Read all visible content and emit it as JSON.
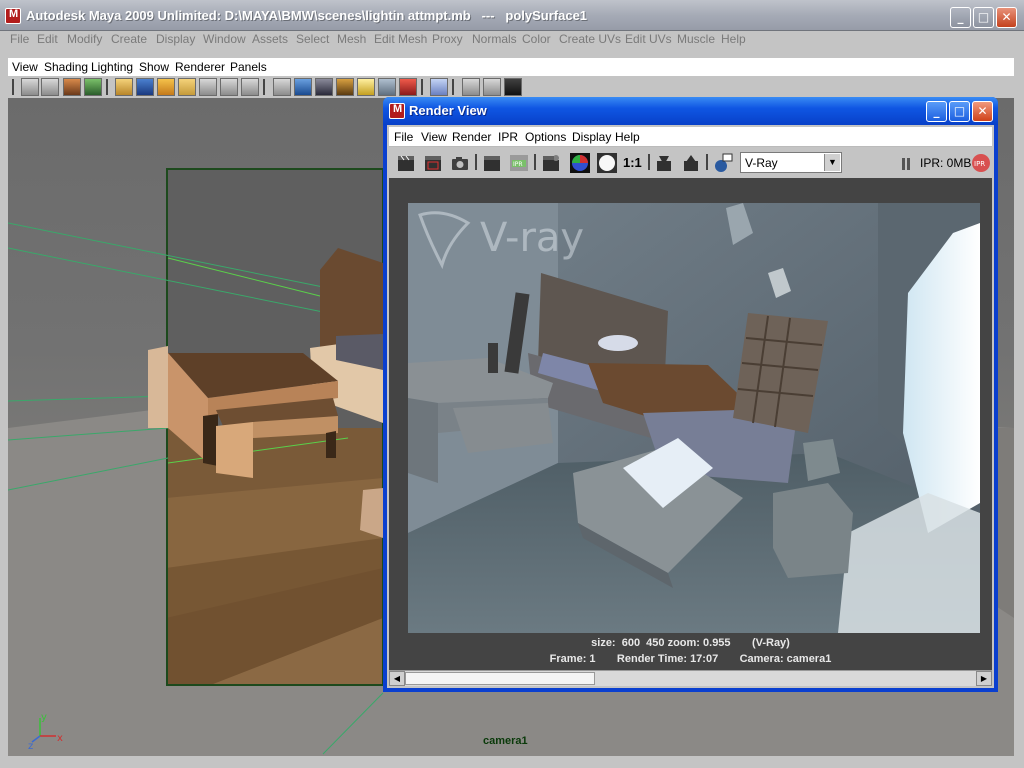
{
  "main_window": {
    "title": "Autodesk Maya 2009 Unlimited: D:\\MAYA\\BMW\\scenes\\lightin attmpt.mb   ---   polySurface1",
    "controls": {
      "minimize": "_",
      "maximize": "□",
      "close": "✕"
    }
  },
  "main_menu": [
    "File",
    "Edit",
    "Modify",
    "Create",
    "Display",
    "Window",
    "Assets",
    "Select",
    "Mesh",
    "Edit Mesh",
    "Proxy",
    "Normals",
    "Color",
    "Create UVs",
    "Edit UVs",
    "Muscle",
    "Help"
  ],
  "panel_menu": [
    "View",
    "Shading",
    "Lighting",
    "Show",
    "Renderer",
    "Panels"
  ],
  "viewport": {
    "camera_label": "camera1",
    "axis": {
      "x": "x",
      "y": "y",
      "z": "z"
    }
  },
  "render_view": {
    "title": "Render View",
    "controls": {
      "minimize": "_",
      "maximize": "□",
      "close": "✕"
    },
    "menu": [
      "File",
      "View",
      "Render",
      "IPR",
      "Options",
      "Display",
      "Help"
    ],
    "toolbar": {
      "ratio_label": "1:1",
      "renderer_selected": "V-Ray",
      "ipr_status": "IPR: 0MB",
      "ipr_badge": "IPR"
    },
    "watermark": "V-ray",
    "info": {
      "size_line": "size:  600  450 zoom: 0.955       (V-Ray)",
      "frame_line": "Frame: 1       Render Time: 17:07       Camera: camera1"
    }
  },
  "colors": {
    "titlebar_xp_blue": "#0f56e3",
    "wire_green": "#1f8a2a",
    "close_red": "#d0421a"
  }
}
